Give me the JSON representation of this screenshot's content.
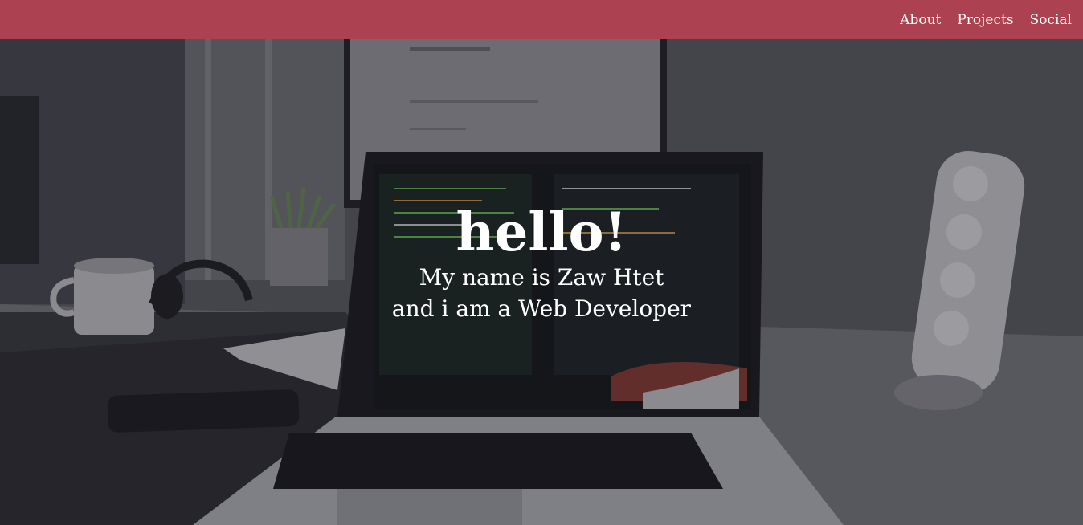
{
  "nav": {
    "links": [
      {
        "label": "About"
      },
      {
        "label": "Projects"
      },
      {
        "label": "Social"
      }
    ]
  },
  "hero": {
    "title": "hello!",
    "line1": "My name is Zaw Htet",
    "line2": "and i am a Web Developer"
  },
  "colors": {
    "navbar": "#ac4152",
    "text": "#ffffff"
  }
}
